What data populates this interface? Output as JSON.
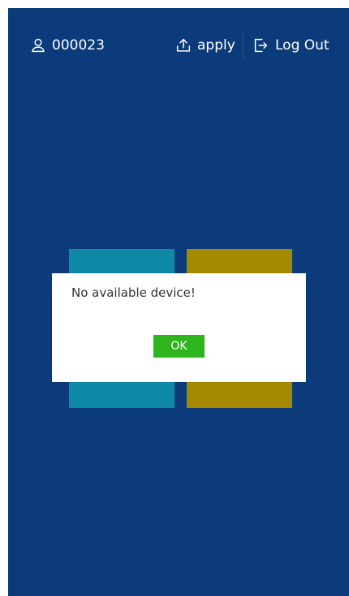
{
  "header": {
    "user_id": "000023",
    "apply_label": "apply",
    "logout_label": "Log Out"
  },
  "dialog": {
    "message": "No available device!",
    "ok_label": "OK"
  },
  "colors": {
    "background": "#0b3b7a",
    "tile_left": "#0e8aa6",
    "tile_right": "#a48a00",
    "ok_button": "#2db51b"
  },
  "icons": {
    "user": "user-icon",
    "apply": "upload-icon",
    "logout": "logout-icon"
  }
}
